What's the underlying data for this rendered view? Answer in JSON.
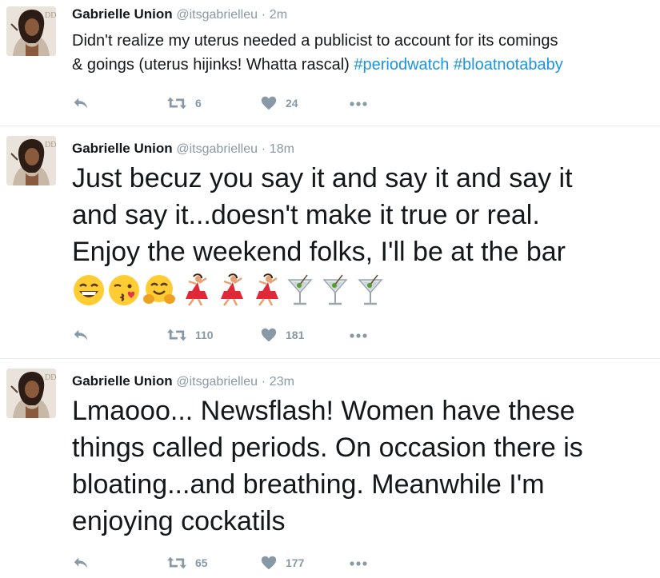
{
  "colors": {
    "link": "#1b95e0",
    "muted": "#8899a6",
    "text": "#14171a",
    "divider": "#e6ecf0"
  },
  "tweets": [
    {
      "name": "Gabrielle Union",
      "handle": "@itsgabrielleu",
      "dot": "·",
      "time": "2m",
      "text_line1": "Didn't realize my uterus needed a publicist to account for its comings",
      "text_line2_plain": "& goings (uterus hijinks! Whatta rascal) ",
      "hashtag1": "#periodwatch",
      "hashtag2": "#bloatnotababy",
      "retweets": "6",
      "likes": "24"
    },
    {
      "name": "Gabrielle Union",
      "handle": "@itsgabrielleu",
      "dot": "·",
      "time": "18m",
      "lines": [
        "Just becuz you say it and say it and say it",
        "and say it...doesn't make it true or real.",
        "Enjoy the weekend folks, I'll be at the bar"
      ],
      "emojis": [
        "grinning-face-emoji",
        "kissing-face-emoji",
        "hugging-face-emoji",
        "dancer-emoji",
        "dancer-emoji",
        "dancer-emoji",
        "cocktail-emoji",
        "cocktail-emoji",
        "cocktail-emoji"
      ],
      "retweets": "110",
      "likes": "181"
    },
    {
      "name": "Gabrielle Union",
      "handle": "@itsgabrielleu",
      "dot": "·",
      "time": "23m",
      "lines": [
        "Lmaooo... Newsflash! Women have these",
        "things called periods. On occasion there is",
        "bloating...and breathing. Meanwhile I'm",
        "enjoying cockatils"
      ],
      "retweets": "65",
      "likes": "177"
    }
  ]
}
